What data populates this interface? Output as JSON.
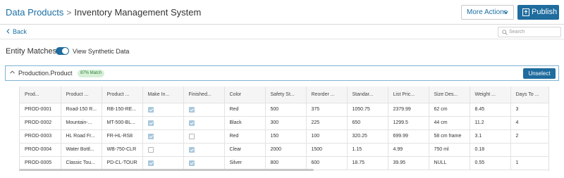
{
  "header": {
    "breadcrumb_root": "Data Products",
    "separator": ">",
    "title": "Inventory Management System",
    "more_actions_label": "More Actions",
    "publish_label": "Publish",
    "publish_icon": "publish-icon",
    "accent_color": "#1f6c9e"
  },
  "subbar": {
    "back_label": "Back",
    "search_placeholder": "Search"
  },
  "entity": {
    "title": "Entity Matches",
    "toggle_label": "View Synthetic Data",
    "toggle_on": true
  },
  "section": {
    "name": "Production.Product",
    "match_badge": "87% Match",
    "unselect_label": "Unselect"
  },
  "table": {
    "columns": [
      "Prod...",
      "Product ...",
      "Product ...",
      "Make In...",
      "Finished...",
      "Color",
      "Safety St...",
      "Reorder ...",
      "Standar...",
      "List Pric...",
      "Size Des...",
      "Weight ...",
      "Days To ..."
    ],
    "rows": [
      {
        "id": "PROD-0001",
        "name": "Road-150 R...",
        "number": "RB-150-RE...",
        "make": true,
        "finished": true,
        "color": "Red",
        "safety": "500",
        "reorder": "375",
        "std": "1050.75",
        "list": "2379.99",
        "size": "62 cm",
        "weight": "8.45",
        "days": "3"
      },
      {
        "id": "PROD-0002",
        "name": "Mountain-...",
        "number": "MT-500-BL...",
        "make": true,
        "finished": true,
        "color": "Black",
        "safety": "300",
        "reorder": "225",
        "std": "650",
        "list": "1299.5",
        "size": "44 cm",
        "weight": "11.2",
        "days": "4"
      },
      {
        "id": "PROD-0003",
        "name": "HL Road Fr...",
        "number": "FR-HL-RS8",
        "make": true,
        "finished": false,
        "color": "Red",
        "safety": "150",
        "reorder": "100",
        "std": "320.25",
        "list": "699.99",
        "size": "58 cm frame",
        "weight": "3.1",
        "days": "2"
      },
      {
        "id": "PROD-0004",
        "name": "Water Bottl...",
        "number": "WB-750-CLR",
        "make": false,
        "finished": true,
        "color": "Clear",
        "safety": "2000",
        "reorder": "1500",
        "std": "1.15",
        "list": "4.99",
        "size": "750 ml",
        "weight": "0.18",
        "days": ""
      },
      {
        "id": "PROD-0005",
        "name": "Classic Tou...",
        "number": "PD-CL-TOUR",
        "make": true,
        "finished": true,
        "color": "Silver",
        "safety": "800",
        "reorder": "600",
        "std": "18.75",
        "list": "39.95",
        "size": "NULL",
        "weight": "0.55",
        "days": "1"
      }
    ]
  }
}
